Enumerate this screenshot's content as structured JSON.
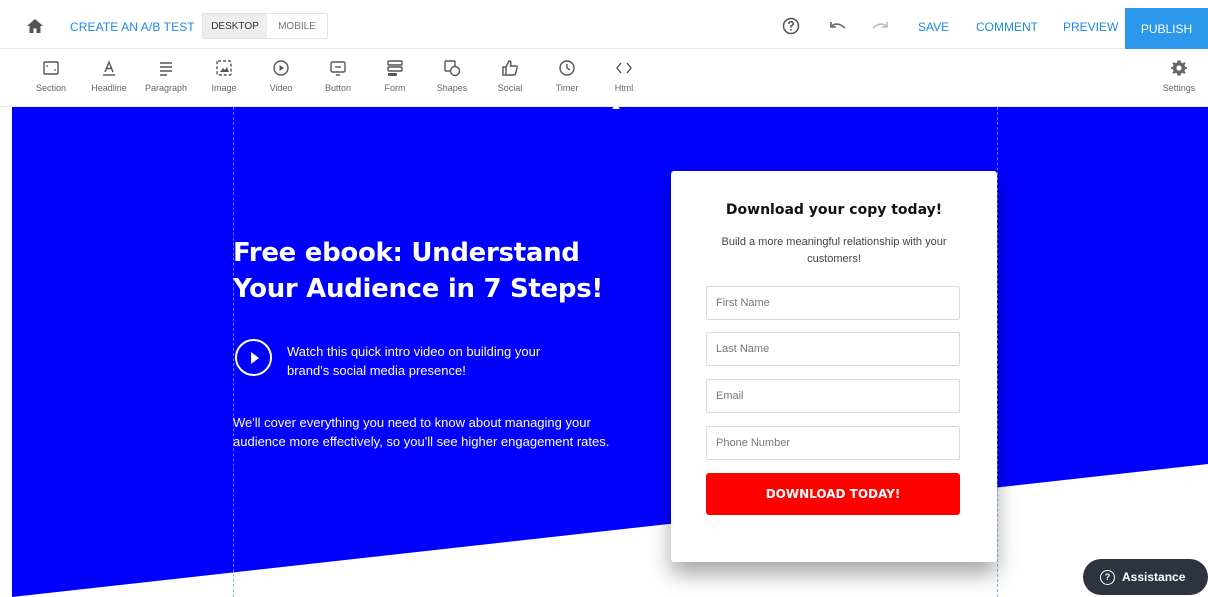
{
  "topbar": {
    "ab_test_label": "CREATE AN A/B TEST",
    "device_desktop": "DESKTOP",
    "device_mobile": "MOBILE",
    "save_label": "SAVE",
    "comment_label": "COMMENT",
    "preview_label": "PREVIEW",
    "publish_label": "PUBLISH"
  },
  "toolbar": {
    "items": [
      {
        "label": "Section",
        "icon": "section-icon"
      },
      {
        "label": "Headline",
        "icon": "headline-icon"
      },
      {
        "label": "Paragraph",
        "icon": "paragraph-icon"
      },
      {
        "label": "Image",
        "icon": "image-icon"
      },
      {
        "label": "Video",
        "icon": "video-icon"
      },
      {
        "label": "Button",
        "icon": "button-icon"
      },
      {
        "label": "Form",
        "icon": "form-icon"
      },
      {
        "label": "Shapes",
        "icon": "shapes-icon"
      },
      {
        "label": "Social",
        "icon": "social-icon"
      },
      {
        "label": "Timer",
        "icon": "timer-icon"
      },
      {
        "label": "Html",
        "icon": "html-icon"
      }
    ],
    "settings_label": "Settings"
  },
  "page": {
    "headline": "Free ebook: Understand Your Audience in 7 Steps!",
    "video_text": "Watch this quick intro video on building your brand's social media presence!",
    "body_text": "We'll cover everything you need to know about managing your audience more effectively, so you'll see higher engagement rates.",
    "form": {
      "title": "Download your copy today!",
      "subtitle": "Build a more meaningful relationship with your customers!",
      "first_name_placeholder": "First Name",
      "last_name_placeholder": "Last Name",
      "email_placeholder": "Email",
      "phone_placeholder": "Phone Number",
      "cta_label": "DOWNLOAD TODAY!"
    }
  },
  "assistance_label": "Assistance",
  "colors": {
    "brand_blue": "#0000ff",
    "publish_blue": "#2c98ec",
    "link_blue": "#1e88e5",
    "cta_red": "#ff0000"
  }
}
